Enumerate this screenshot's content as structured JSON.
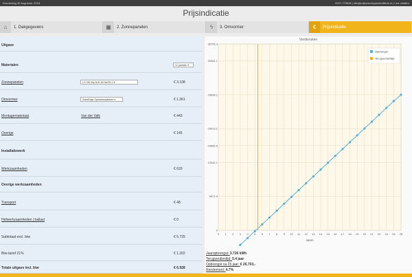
{
  "topbar": {
    "date": "Donderdag 30 Augustus, 2018",
    "contact": "0297-775638 | info@mijnzonnepaneleofferte.nl | Live chatten"
  },
  "page_title": "Prijsindicatie",
  "steps": [
    {
      "label": "1. Dakgegevens",
      "icon": "home-icon",
      "glyph": "⌂"
    },
    {
      "label": "2. Zonnepanelen",
      "icon": "panel-icon",
      "glyph": "▦"
    },
    {
      "label": "3. Omvormer",
      "icon": "bolt-icon",
      "glyph": "ϟ"
    },
    {
      "label": "Prijsindicatie",
      "icon": "euro-icon",
      "glyph": "€"
    }
  ],
  "cost_rows": [
    {
      "label": "Uitgave",
      "style": "header"
    },
    {
      "label": "Materialen",
      "style": "header",
      "select": "12 panelen"
    },
    {
      "label": "Zonnepanelen",
      "style": "link",
      "select": "LG 330 Wp N1K-A5 NeON 2",
      "price": "€ 3.108"
    },
    {
      "label": "Omvormer",
      "style": "link",
      "select": "SolarEdge Optimizersysteem",
      "price": "€ 1.361"
    },
    {
      "label": "Montagemateriaal",
      "style": "link",
      "mid": "Van der Valk",
      "price": "€ 443"
    },
    {
      "label": "Overige",
      "style": "link",
      "price": "€ 145"
    },
    {
      "label": "Installatiewerk",
      "style": "header"
    },
    {
      "label": "Werkzaamheden",
      "style": "link",
      "price": "€ 620"
    },
    {
      "label": "Overige werkzaamheden",
      "style": "header"
    },
    {
      "label": "Transport",
      "style": "link",
      "price": "€ 48"
    },
    {
      "label": "Hefwerkzaamheden | ballast",
      "style": "link",
      "price": "€ 0"
    },
    {
      "label": "Subtotaal excl. btw",
      "style": "plain",
      "price": "€ 5.725"
    },
    {
      "label": "Btw-tarief 21%",
      "style": "plain",
      "price": "€ 1.202"
    },
    {
      "label": "Totale uitgave incl. btw",
      "style": "total",
      "price": "€ 6.928"
    }
  ],
  "summary": [
    {
      "label": "Jaaropbrengst:",
      "value": "3.726 kWh"
    },
    {
      "label": "Terugverdientijd:",
      "value": "5.4 jaar"
    },
    {
      "label": "Opbrengst na 25 jaar:",
      "value": "€ 26.703,-"
    },
    {
      "label": "Rendement:",
      "value": "4.7%"
    }
  ],
  "colors": {
    "accent": "#f1b51b",
    "line": "#5aaed1",
    "payback": "#f5a623"
  },
  "chart_data": {
    "type": "line",
    "title": "Verdiensten",
    "xlabel": "Jaren",
    "ylabel": "",
    "x": [
      0,
      1,
      2,
      3,
      4,
      5,
      6,
      7,
      8,
      9,
      10,
      11,
      12,
      13,
      14,
      15,
      16,
      17,
      18,
      19,
      20,
      21,
      22,
      23,
      24,
      25
    ],
    "xlim": [
      0,
      25
    ],
    "ylim": [
      0,
      36705.3
    ],
    "y_ticks": [
      "0",
      "6671.0",
      "13342.1",
      "16689.5",
      "20013.1",
      "26698.1",
      "33361.1",
      "36705.3"
    ],
    "y_tick_values": [
      0,
      6671.0,
      13342.1,
      16689.5,
      20013.1,
      26698.1,
      33361.1,
      36705.3
    ],
    "series": [
      {
        "name": "Opbrengst",
        "values": [
          -6928,
          -5579,
          -4230,
          -2881,
          -1532,
          -183,
          1166,
          2515,
          3864,
          5213,
          6562,
          7911,
          9260,
          10609,
          11958,
          13307,
          14656,
          16005,
          17354,
          18703,
          20052,
          21401,
          22750,
          24099,
          25448,
          26703
        ]
      },
      {
        "name": "Terugverdientijd",
        "x": 5.4
      }
    ],
    "grid": true,
    "legend": "top-right"
  }
}
